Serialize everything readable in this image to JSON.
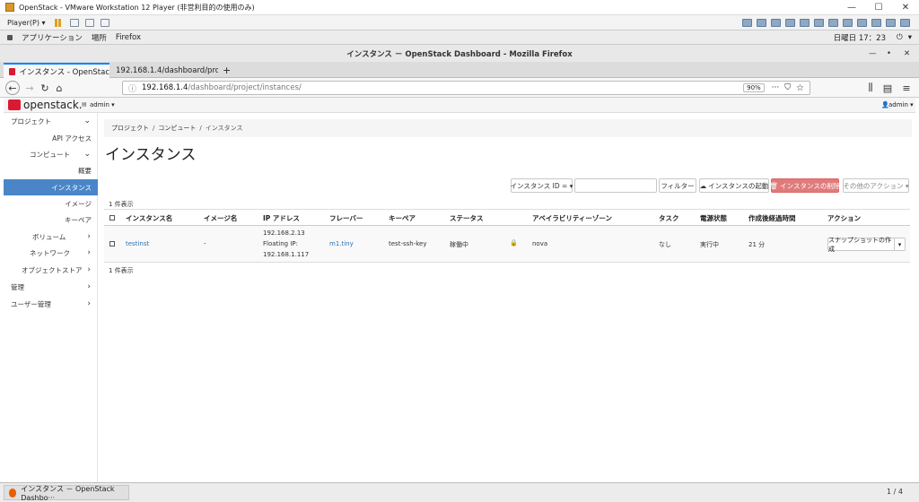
{
  "vmware": {
    "title": "OpenStack - VMware Workstation 12 Player (非営利目的の使用のみ)",
    "player_menu": "Player(P) ▾",
    "win_min": "—",
    "win_max": "☐",
    "win_close": "✕"
  },
  "gnome": {
    "apps": "アプリケーション",
    "places": "場所",
    "firefox": "Firefox",
    "clock": "日曜日 17：23"
  },
  "firefox": {
    "window_title": "インスタンス － OpenStack Dashboard - Mozilla Firefox",
    "tabs": [
      {
        "label": "インスタンス - OpenStac"
      },
      {
        "label": "192.168.1.4/dashboard/proje"
      }
    ],
    "url_host": "192.168.1.4",
    "url_path": "/dashboard/project/instances/",
    "zoom": "90%",
    "more": "···"
  },
  "os": {
    "logo": "openstack.",
    "project_selector": "admin ▾",
    "user_menu": "admin ▾"
  },
  "sidebar": {
    "project": "プロジェクト",
    "api_access": "API アクセス",
    "compute": "コンピュート",
    "overview": "概要",
    "instances": "インスタンス",
    "images": "イメージ",
    "keypairs": "キーペア",
    "volumes": "ボリューム",
    "network": "ネットワーク",
    "object_store": "オブジェクトストア",
    "admin": "管理",
    "identity": "ユーザー管理"
  },
  "page": {
    "breadcrumb": [
      "プロジェクト",
      "コンピュート",
      "インスタンス"
    ],
    "title": "インスタンス",
    "filter_select": "インスタンス ID = ▾",
    "filter_placeholder": "",
    "filter_button": "フィルター",
    "launch_button": "インスタンスの起動",
    "delete_button": "インスタンスの削除",
    "more_actions": "その他のアクション ▾",
    "count_top": "1 件表示",
    "count_bottom": "1 件表示"
  },
  "table": {
    "headers": [
      "インスタンス名",
      "イメージ名",
      "IP アドレス",
      "フレーバー",
      "キーペア",
      "ステータス",
      "アベイラビリティーゾーン",
      "タスク",
      "電源状態",
      "作成後経過時間",
      "アクション"
    ],
    "row": {
      "name": "testinst",
      "image": "-",
      "ip1": "192.168.2.13",
      "ip2": "Floating IP:",
      "ip3": "192.168.1.117",
      "flavor": "m1.tiny",
      "keypair": "test-ssh-key",
      "status": "稼働中",
      "az": "nova",
      "task": "なし",
      "power": "実行中",
      "age": "21 分",
      "action": "スナップショットの作成"
    }
  },
  "taskbar": {
    "item": "インスタンス － OpenStack Dashbo···",
    "pager": "1 / 4"
  },
  "colors": {
    "accent": "#4a86c7",
    "danger": "#e07b7b",
    "link": "#2a70b8",
    "brand": "#da1a32"
  }
}
